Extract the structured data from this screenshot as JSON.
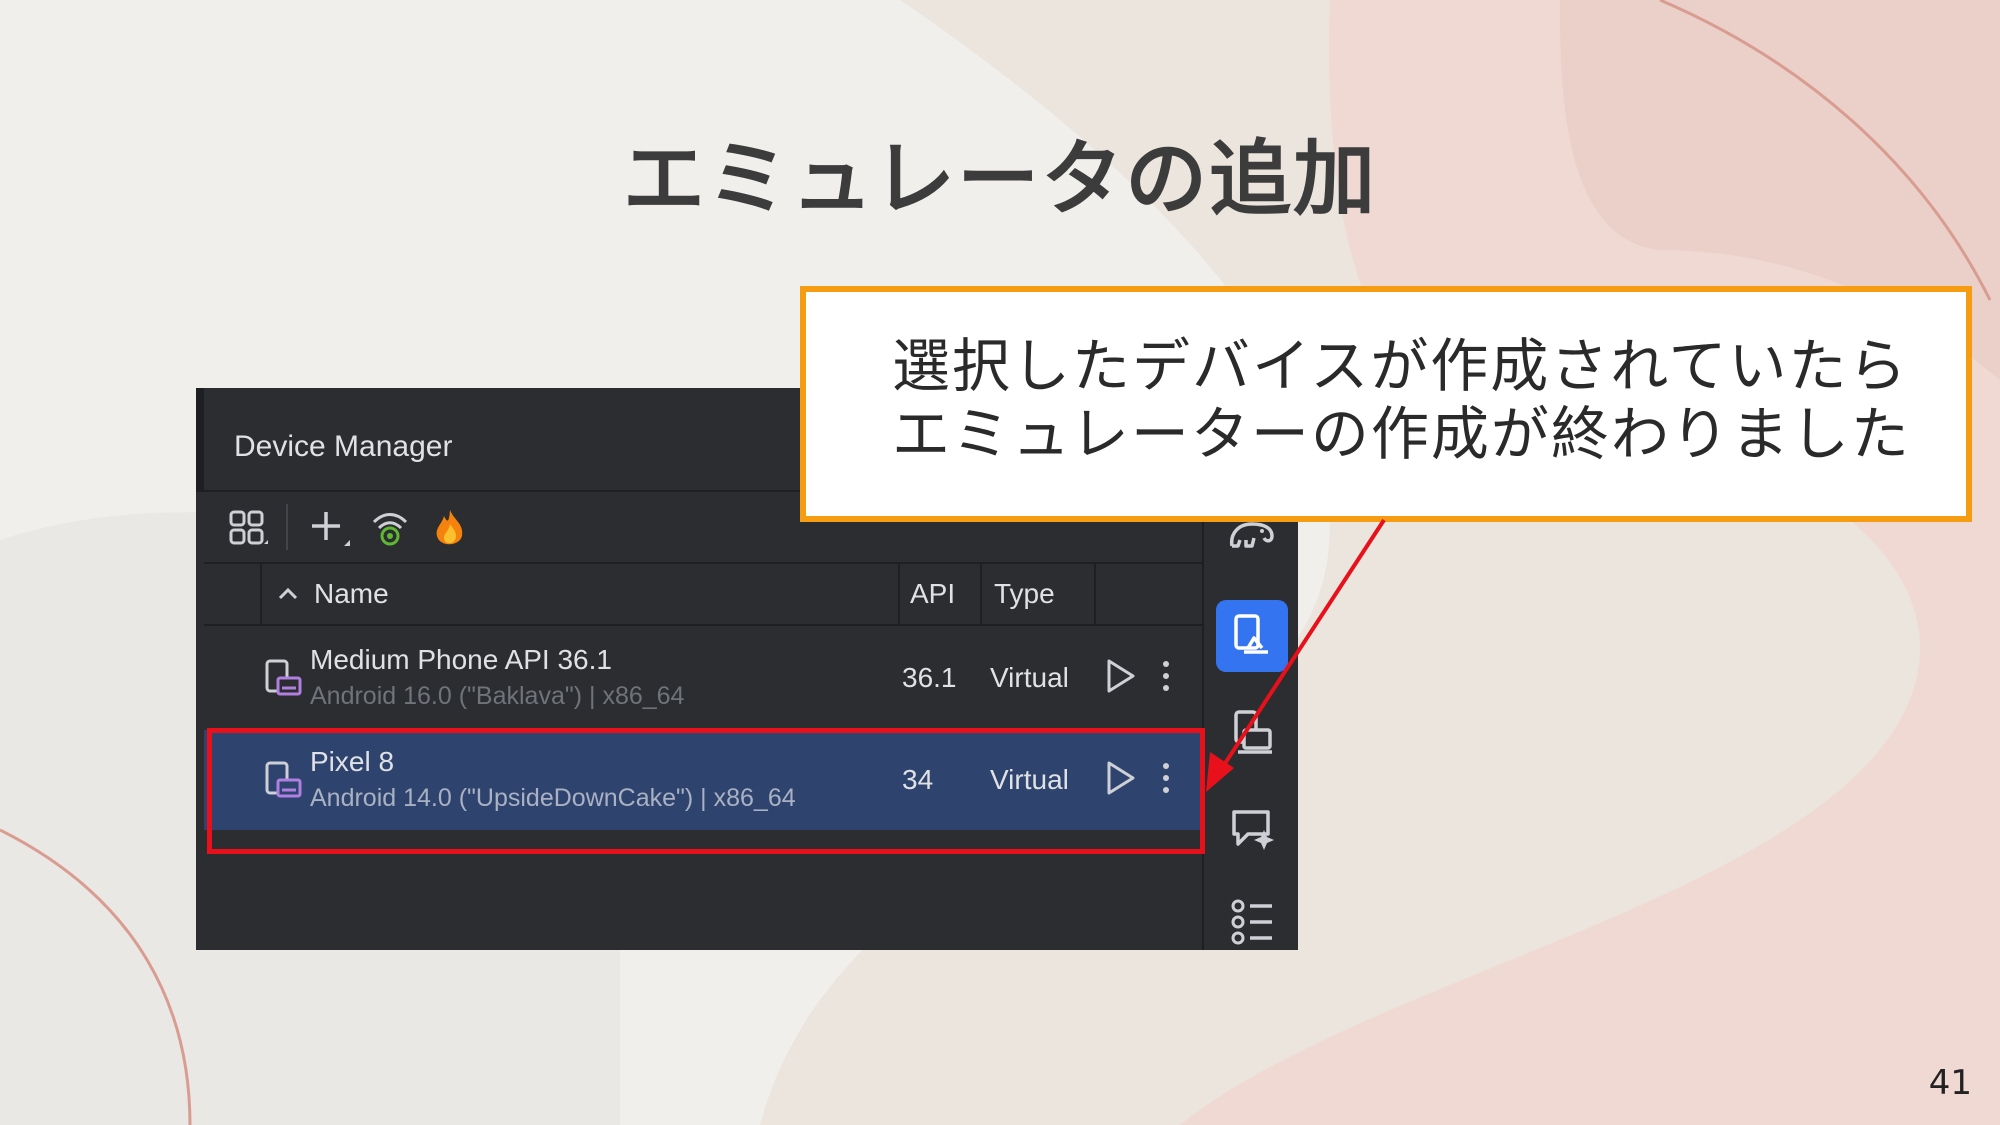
{
  "slide": {
    "title": "エミュレータの追加",
    "page_number": "41"
  },
  "device_manager": {
    "title": "Device Manager",
    "toolbar": {
      "icons": [
        "device-grid-icon",
        "add-device-icon",
        "wifi-pairing-icon",
        "firebase-icon"
      ]
    },
    "columns": {
      "name": "Name",
      "api": "API",
      "type": "Type"
    },
    "devices": [
      {
        "name": "Medium Phone API 36.1",
        "detail": "Android 16.0 (\"Baklava\") | x86_64",
        "api": "36.1",
        "type": "Virtual",
        "selected": false
      },
      {
        "name": "Pixel 8",
        "detail": "Android 14.0 (\"UpsideDownCake\") | x86_64",
        "api": "34",
        "type": "Virtual",
        "selected": true
      }
    ],
    "side_icons": [
      "gradle-elephant-icon",
      "device-manager-icon",
      "running-devices-icon",
      "assistant-icon",
      "structure-list-icon"
    ]
  },
  "callout": {
    "line1": "選択したデバイスが作成されていたら",
    "line2": "エミュレーターの作成が終わりました"
  },
  "colors": {
    "highlight_border": "#e8101a",
    "callout_border": "#f59c12",
    "selected_row": "#2e436e",
    "accent_blue": "#3574f0",
    "panel_bg": "#2b2d30"
  }
}
